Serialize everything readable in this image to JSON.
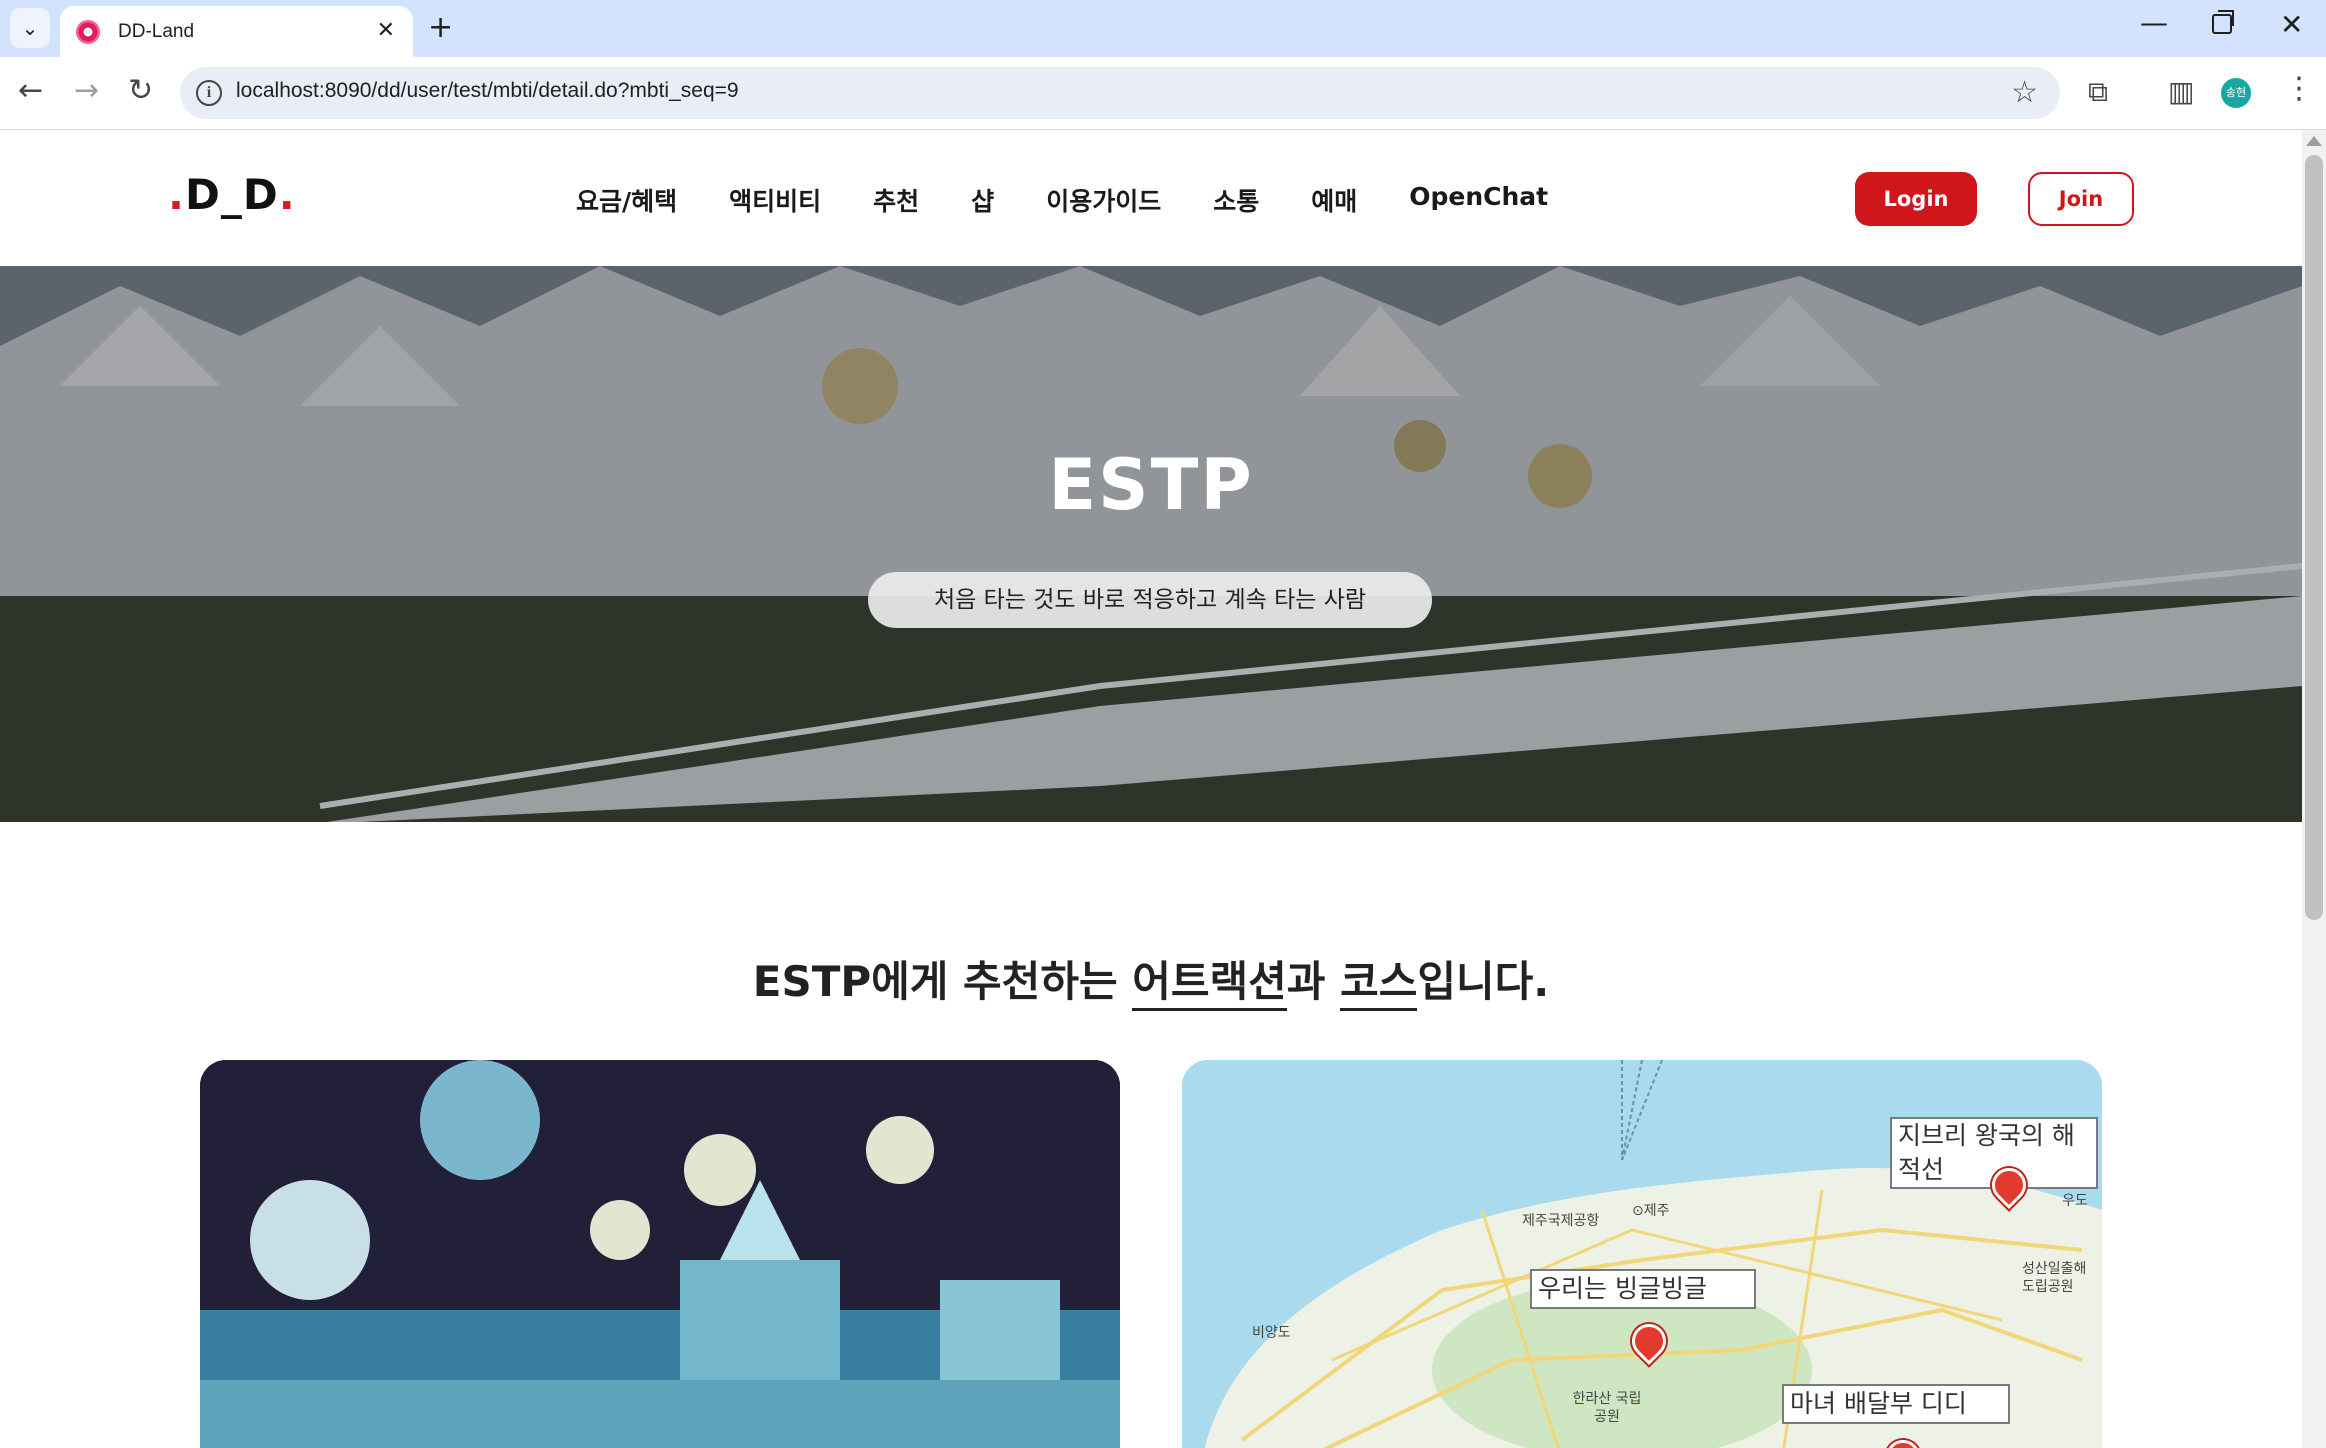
{
  "browser": {
    "tab_title": "DD-Land",
    "url": "localhost:8090/dd/user/test/mbti/detail.do?mbti_seq=9",
    "profile_initials": "송현"
  },
  "site": {
    "logo": {
      "prefix": ".",
      "main": "D_D",
      "suffix": "."
    },
    "nav": [
      "요금/혜택",
      "액티비티",
      "추천",
      "샵",
      "이용가이드",
      "소통",
      "예매",
      "OpenChat"
    ],
    "login_label": "Login",
    "join_label": "Join"
  },
  "hero": {
    "title": "ESTP",
    "subtitle": "처음 타는 것도 바로 적응하고 계속 타는 사람"
  },
  "section": {
    "title_prefix": "ESTP에게 추천하는 ",
    "title_attraction": "어트랙션",
    "title_mid": "과 ",
    "title_course": "코스",
    "title_suffix": "입니다."
  },
  "map": {
    "labels": [
      "지브리 왕국의 해적선",
      "우리는 빙글빙글",
      "마녀 배달부 디디"
    ],
    "places": [
      "제주국제공항",
      "⊙제주",
      "비양도",
      "한라산 국립공원",
      "성산일출해 도립공원",
      "우도"
    ]
  },
  "colors": {
    "brand_red": "#d0161b",
    "tab_strip": "#d3e3fd"
  }
}
